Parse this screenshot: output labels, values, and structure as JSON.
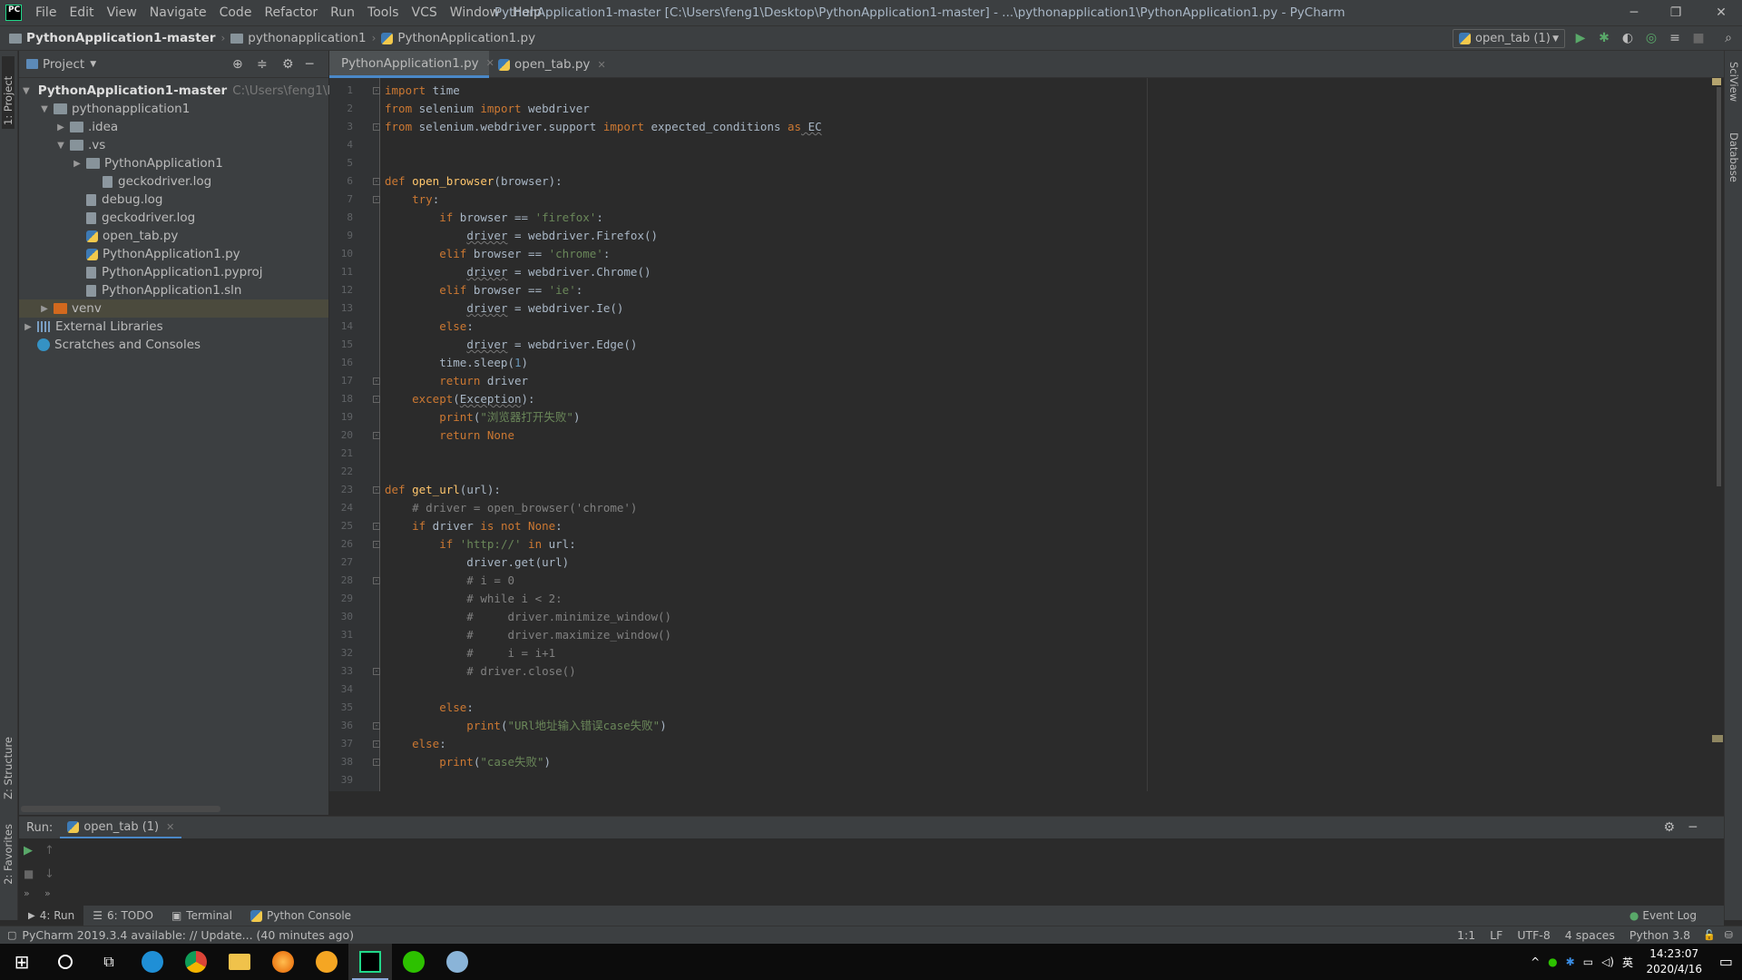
{
  "titlebar": {
    "app_icon": "PC",
    "menu": [
      "File",
      "Edit",
      "View",
      "Navigate",
      "Code",
      "Refactor",
      "Run",
      "Tools",
      "VCS",
      "Window",
      "Help"
    ],
    "window_title": "PythonApplication1-master [C:\\Users\\feng1\\Desktop\\PythonApplication1-master] - ...\\pythonapplication1\\PythonApplication1.py - PyCharm"
  },
  "navbar": {
    "crumbs": [
      "PythonApplication1-master",
      "pythonapplication1",
      "PythonApplication1.py"
    ],
    "run_config": "open_tab (1)"
  },
  "strips": {
    "project": "1: Project",
    "structure": "Z: Structure",
    "favorites": "2: Favorites",
    "sciview": "SciView",
    "database": "Database"
  },
  "project": {
    "title": "Project",
    "tree": [
      {
        "label": "PythonApplication1-master",
        "extra": "C:\\Users\\feng1\\Deskt",
        "depth": 0,
        "type": "folder",
        "arrow": "▼",
        "bold": true
      },
      {
        "label": "pythonapplication1",
        "depth": 1,
        "type": "folder",
        "arrow": "▼"
      },
      {
        "label": ".idea",
        "depth": 2,
        "type": "folder",
        "arrow": "▶"
      },
      {
        "label": ".vs",
        "depth": 2,
        "type": "folder",
        "arrow": "▼"
      },
      {
        "label": "PythonApplication1",
        "depth": 3,
        "type": "folder",
        "arrow": "▶"
      },
      {
        "label": "geckodriver.log",
        "depth": 4,
        "type": "file",
        "arrow": ""
      },
      {
        "label": "debug.log",
        "depth": 3,
        "type": "file",
        "arrow": ""
      },
      {
        "label": "geckodriver.log",
        "depth": 3,
        "type": "file",
        "arrow": ""
      },
      {
        "label": "open_tab.py",
        "depth": 3,
        "type": "py",
        "arrow": ""
      },
      {
        "label": "PythonApplication1.py",
        "depth": 3,
        "type": "py",
        "arrow": ""
      },
      {
        "label": "PythonApplication1.pyproj",
        "depth": 3,
        "type": "file",
        "arrow": ""
      },
      {
        "label": "PythonApplication1.sln",
        "depth": 3,
        "type": "file",
        "arrow": ""
      },
      {
        "label": "venv",
        "depth": 1,
        "type": "venv",
        "arrow": "▶",
        "selected": true
      },
      {
        "label": "External Libraries",
        "depth": 0,
        "type": "lib",
        "arrow": "▶"
      },
      {
        "label": "Scratches and Consoles",
        "depth": 0,
        "type": "scratch",
        "arrow": ""
      }
    ]
  },
  "editor": {
    "tabs": [
      "PythonApplication1.py",
      "open_tab.py"
    ],
    "active_tab": 0,
    "lines": [
      [
        [
          "k",
          "import"
        ],
        [
          "p",
          " time"
        ]
      ],
      [
        [
          "k",
          "from"
        ],
        [
          "p",
          " selenium "
        ],
        [
          "k",
          "import"
        ],
        [
          "p",
          " webdriver"
        ]
      ],
      [
        [
          "k",
          "from"
        ],
        [
          "p",
          " selenium.webdriver.support "
        ],
        [
          "k",
          "import"
        ],
        [
          "p",
          " expected_conditions "
        ],
        [
          "k",
          "as"
        ],
        [
          "pu",
          " EC"
        ]
      ],
      [],
      [],
      [
        [
          "k",
          "def"
        ],
        [
          "f",
          " open_browser"
        ],
        [
          "p",
          "(browser):"
        ]
      ],
      [
        [
          "k",
          "    try"
        ],
        [
          "p",
          ":"
        ]
      ],
      [
        [
          "k",
          "        if"
        ],
        [
          "p",
          " browser == "
        ],
        [
          "s",
          "'firefox'"
        ],
        [
          "p",
          ":"
        ]
      ],
      [
        [
          "p",
          "            "
        ],
        [
          "pu",
          "driver"
        ],
        [
          "p",
          " = webdriver.Firefox()"
        ]
      ],
      [
        [
          "k",
          "        elif"
        ],
        [
          "p",
          " browser == "
        ],
        [
          "s",
          "'chrome'"
        ],
        [
          "p",
          ":"
        ]
      ],
      [
        [
          "p",
          "            "
        ],
        [
          "pu",
          "driver"
        ],
        [
          "p",
          " = webdriver.Chrome()"
        ]
      ],
      [
        [
          "k",
          "        elif"
        ],
        [
          "p",
          " browser == "
        ],
        [
          "s",
          "'ie'"
        ],
        [
          "p",
          ":"
        ]
      ],
      [
        [
          "p",
          "            "
        ],
        [
          "pu",
          "driver"
        ],
        [
          "p",
          " = webdriver.Ie()"
        ]
      ],
      [
        [
          "k",
          "        else"
        ],
        [
          "p",
          ":"
        ]
      ],
      [
        [
          "p",
          "            "
        ],
        [
          "pu",
          "driver"
        ],
        [
          "p",
          " = webdriver.Edge()"
        ]
      ],
      [
        [
          "p",
          "        time.sleep("
        ],
        [
          "n",
          "1"
        ],
        [
          "p",
          ")"
        ]
      ],
      [
        [
          "k",
          "        return"
        ],
        [
          "p",
          " driver"
        ]
      ],
      [
        [
          "k",
          "    except"
        ],
        [
          "p",
          "("
        ],
        [
          "pu",
          "Exception"
        ],
        [
          "p",
          "):"
        ]
      ],
      [
        [
          "k",
          "        print"
        ],
        [
          "p",
          "("
        ],
        [
          "s",
          "\"浏览器打开失败\""
        ],
        [
          "p",
          ")"
        ]
      ],
      [
        [
          "k",
          "        return"
        ],
        [
          "k",
          " None"
        ]
      ],
      [],
      [],
      [
        [
          "k",
          "def"
        ],
        [
          "f",
          " get_url"
        ],
        [
          "p",
          "(url):"
        ]
      ],
      [
        [
          "c",
          "    # driver = open_browser('chrome')"
        ]
      ],
      [
        [
          "k",
          "    if"
        ],
        [
          "p",
          " driver "
        ],
        [
          "k",
          "is not"
        ],
        [
          "k",
          " None"
        ],
        [
          "p",
          ":"
        ]
      ],
      [
        [
          "k",
          "        if"
        ],
        [
          "s",
          " 'http://'"
        ],
        [
          "k",
          " in"
        ],
        [
          "p",
          " url:"
        ]
      ],
      [
        [
          "p",
          "            driver.get(url)"
        ]
      ],
      [
        [
          "c",
          "            # i = 0"
        ]
      ],
      [
        [
          "c",
          "            # while i < 2:"
        ]
      ],
      [
        [
          "c",
          "            #     driver.minimize_window()"
        ]
      ],
      [
        [
          "c",
          "            #     driver.maximize_window()"
        ]
      ],
      [
        [
          "c",
          "            #     i = i+1"
        ]
      ],
      [
        [
          "c",
          "            # driver.close()"
        ]
      ],
      [],
      [
        [
          "k",
          "        else"
        ],
        [
          "p",
          ":"
        ]
      ],
      [
        [
          "k",
          "            print"
        ],
        [
          "p",
          "("
        ],
        [
          "s",
          "\"URl地址输入错误case失败\""
        ],
        [
          "p",
          ")"
        ]
      ],
      [
        [
          "k",
          "    else"
        ],
        [
          "p",
          ":"
        ]
      ],
      [
        [
          "k",
          "        print"
        ],
        [
          "p",
          "("
        ],
        [
          "s",
          "\"case失败\""
        ],
        [
          "p",
          ")"
        ]
      ],
      []
    ],
    "fold_lines": [
      1,
      3,
      6,
      7,
      17,
      18,
      20,
      23,
      25,
      26,
      28,
      33,
      36,
      37,
      38
    ]
  },
  "run": {
    "label": "Run:",
    "tab": "open_tab (1)"
  },
  "tool_tabs": [
    "4: Run",
    "6: TODO",
    "Terminal",
    "Python Console"
  ],
  "event_log": "Event Log",
  "status": {
    "message": "PyCharm 2019.3.4 available: // Update... (40 minutes ago)",
    "position": "1:1",
    "line_sep": "LF",
    "encoding": "UTF-8",
    "indent": "4 spaces",
    "interpreter": "Python 3.8"
  },
  "taskbar": {
    "time": "14:23:07",
    "date": "2020/4/16",
    "ime": "英"
  },
  "colors": {
    "keyword": "#cc7832",
    "string": "#6a8759",
    "comment": "#808080",
    "function": "#ffc66d",
    "number": "#6897bb",
    "accent": "#4a88c7"
  }
}
